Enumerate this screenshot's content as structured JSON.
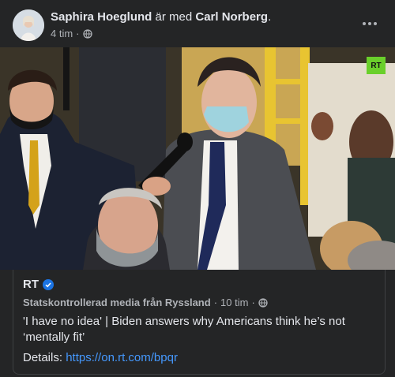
{
  "post": {
    "author": "Saphira Hoeglund",
    "with_text": "är med",
    "tagged": "Carl Norberg",
    "suffix": ".",
    "time": "4 tim",
    "audience_icon": "globe-icon",
    "more_icon": "more-horizontal-icon"
  },
  "photo": {
    "watermark": "RT"
  },
  "link_card": {
    "source_name": "RT",
    "source_label": "Statskontrollerad media från Ryssland",
    "source_time": "10 tim",
    "headline": "'I have no idea' | Biden answers why Americans think he’s not ‘mentally fit’",
    "details_label": "Details:",
    "details_link": "https://on.rt.com/bpqr"
  },
  "colors": {
    "background": "#242526",
    "link": "#4599ff",
    "verified": "#1b74e4",
    "secondary_text": "#b0b3b8"
  }
}
